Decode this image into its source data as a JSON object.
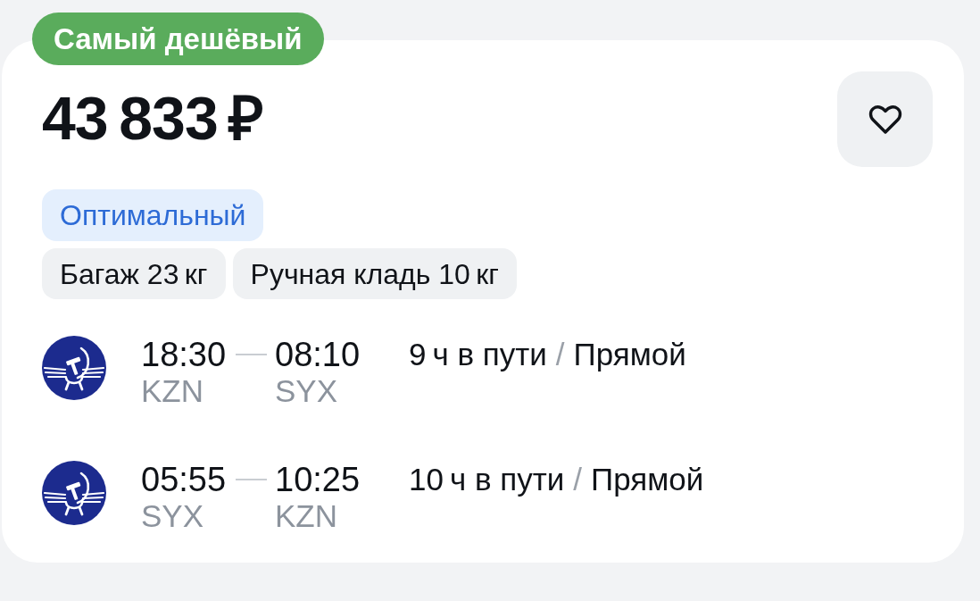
{
  "offer": {
    "badge": "Самый дешёвый",
    "price": "43 833 ₽",
    "favorite": {
      "selected": false
    },
    "fare_label": "Оптимальный",
    "tags": [
      "Багаж 23 кг",
      "Ручная кладь 10 кг"
    ],
    "flights": [
      {
        "departure_time": "18:30",
        "arrival_time": "08:10",
        "departure_airport": "KZN",
        "arrival_airport": "SYX",
        "duration": "9 ч в пути",
        "separator": "/",
        "stops": "Прямой"
      },
      {
        "departure_time": "05:55",
        "arrival_time": "10:25",
        "departure_airport": "SYX",
        "arrival_airport": "KZN",
        "duration": "10 ч в пути",
        "separator": "/",
        "stops": "Прямой"
      }
    ]
  }
}
